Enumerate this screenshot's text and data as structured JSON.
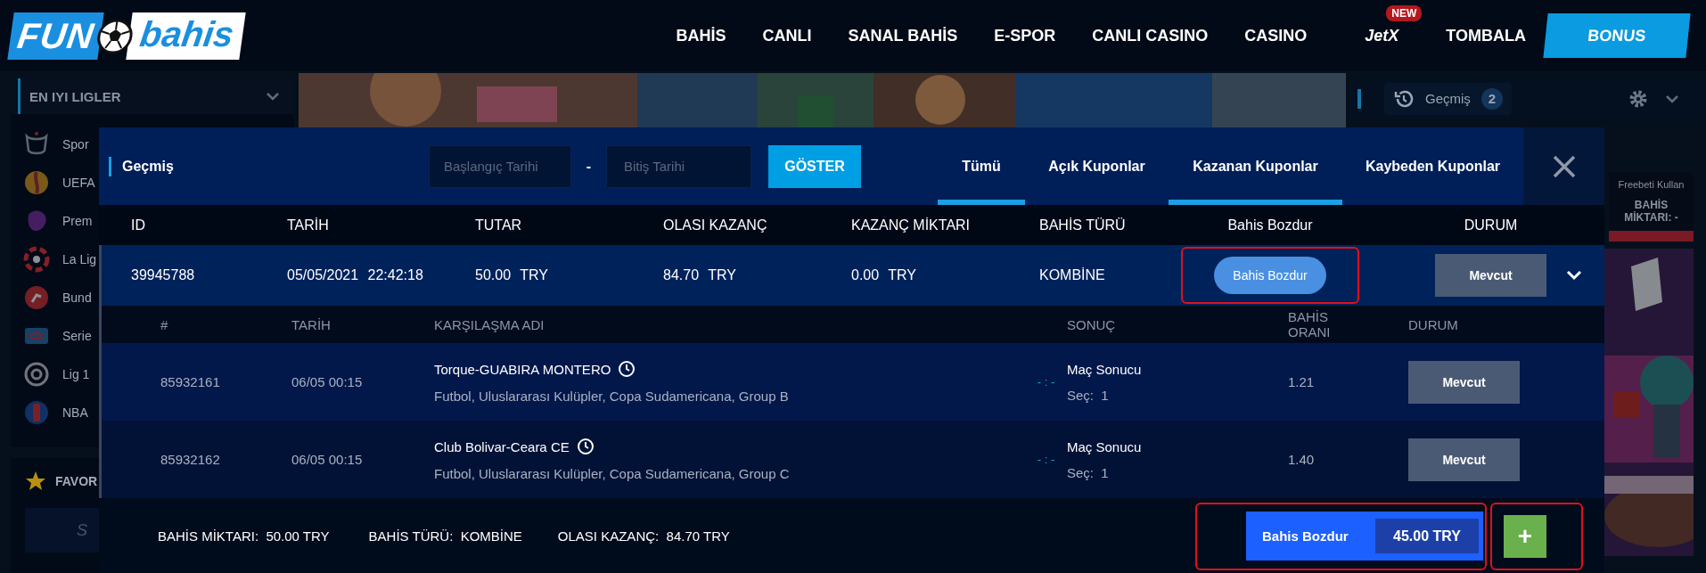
{
  "header": {
    "logo": {
      "part_1": "FUN",
      "part_2": "bahis"
    },
    "nav": [
      {
        "label": "BAHİS",
        "kind": "link"
      },
      {
        "label": "CANLI",
        "kind": "link"
      },
      {
        "label": "SANAL BAHİS",
        "kind": "link"
      },
      {
        "label": "E-SPOR",
        "kind": "link"
      },
      {
        "label": "CANLI CASINO",
        "kind": "link"
      },
      {
        "label": "CASINO",
        "kind": "link"
      },
      {
        "label": "JetX",
        "kind": "logo",
        "badge": "NEW"
      },
      {
        "label": "TOMBALA",
        "kind": "link"
      },
      {
        "label": "BONUS",
        "kind": "button"
      }
    ]
  },
  "sidebar": {
    "title": "EN IYI LIGLER",
    "leagues": [
      {
        "name": "Spor"
      },
      {
        "name": "UEFA"
      },
      {
        "name": "Prem"
      },
      {
        "name": "La Lig"
      },
      {
        "name": "Bund"
      },
      {
        "name": "Serie"
      },
      {
        "name": "Lig 1"
      },
      {
        "name": "NBA"
      }
    ],
    "favorites": {
      "title": "FAVOR",
      "search_placeholder": "S"
    }
  },
  "right_panel": {
    "history_label": "Geçmiş",
    "history_count": "2",
    "freebet_label": "Freebeti Kullan",
    "bet_amount_label": "BAHİS MİKTARI: -"
  },
  "modal": {
    "title": "Geçmiş",
    "start_date": {
      "placeholder": "Başlangıç Tarihi"
    },
    "separator": "-",
    "end_date": {
      "placeholder": "Bitiş Tarihi"
    },
    "show_button": "GÖSTER",
    "tabs": [
      {
        "label": "Tümü",
        "selected": true
      },
      {
        "label": "Açık Kuponlar",
        "selected": false
      },
      {
        "label": "Kazanan Kuponlar",
        "selected": true
      },
      {
        "label": "Kaybeden Kuponlar",
        "selected": false
      }
    ],
    "columns": [
      "ID",
      "TARİH",
      "TUTAR",
      "OLASI KAZANÇ",
      "KAZANÇ MİKTARI",
      "BAHİS TÜRÜ",
      "Bahis Bozdur",
      "DURUM"
    ],
    "bet": {
      "id": "39945788",
      "date": "05/05/2021 22:42:18",
      "stake": "50.00 TRY",
      "potential_win": "84.70 TRY",
      "win_amount": "0.00 TRY",
      "bet_type": "KOMBİNE",
      "cashout_button": "Bahis Bozdur",
      "cashout_highlighted": true,
      "status": "Mevcut",
      "expanded": true
    },
    "detail_columns": [
      "#",
      "TARİH",
      "KARŞILAŞMA ADI",
      "SONUÇ",
      "BAHİS ORANI",
      "DURUM"
    ],
    "selections": [
      {
        "id": "85932161",
        "date": "06/05 00:15",
        "match": "Torque-GUABIRA MONTERO",
        "league": "Futbol, Uluslararası Kulüpler, Copa Sudamericana, Group B",
        "score": "- : -",
        "market": "Maç Sonucu",
        "pick": "Seç:  1",
        "odds": "1.21",
        "status": "Mevcut"
      },
      {
        "id": "85932162",
        "date": "06/05 00:15",
        "match": "Club Bolivar-Ceara CE",
        "league": "Futbol, Uluslararası Kulüpler, Copa Sudamericana, Group C",
        "score": "- : -",
        "market": "Maç Sonucu",
        "pick": "Seç:  1",
        "odds": "1.40",
        "status": "Mevcut"
      }
    ],
    "summary": [
      {
        "label": "BAHİS MİKTARI:",
        "value": "50.00 TRY"
      },
      {
        "label": "BAHİS TÜRÜ:",
        "value": "KOMBİNE"
      },
      {
        "label": "OLASI KAZANÇ:",
        "value": "84.70 TRY"
      }
    ],
    "cashout": {
      "label": "Bahis Bozdur",
      "amount": "45.00 TRY",
      "highlighted": true
    },
    "add_button": {
      "label": "+",
      "highlighted": true
    }
  }
}
